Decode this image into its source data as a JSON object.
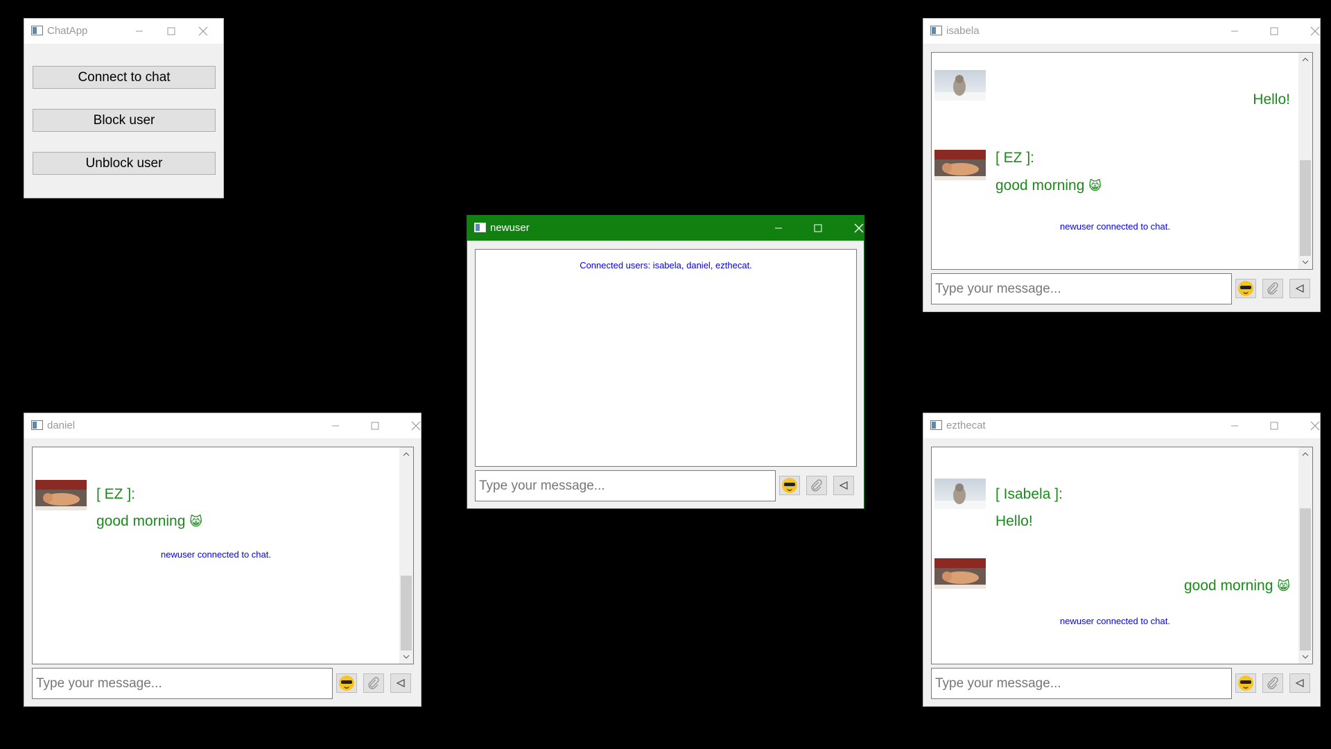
{
  "main_window": {
    "title": "ChatApp",
    "buttons": [
      "Connect to chat",
      "Block user",
      "Unblock user"
    ]
  },
  "windows": {
    "newuser": {
      "title": "newuser",
      "system_message": "Connected users: isabela, daniel, ezthecat.",
      "input_placeholder": "Type your message..."
    },
    "isabela": {
      "title": "isabela",
      "messages": [
        {
          "text": "Hello!",
          "align": "right"
        },
        {
          "sender": "[ EZ ]:",
          "text": "good morning",
          "emoji": "😸"
        }
      ],
      "system_message": "newuser connected to chat.",
      "input_placeholder": "Type your message..."
    },
    "daniel": {
      "title": "daniel",
      "messages": [
        {
          "sender": "[ EZ ]:",
          "text": "good morning",
          "emoji": "😸"
        }
      ],
      "system_message": "newuser connected to chat.",
      "input_placeholder": "Type your message..."
    },
    "ezthecat": {
      "title": "ezthecat",
      "messages": [
        {
          "sender": "[ Isabela ]:",
          "text": "Hello!"
        },
        {
          "text": "good morning",
          "emoji": "😸",
          "align": "right"
        }
      ],
      "system_message": "newuser connected to chat.",
      "input_placeholder": "Type your message..."
    }
  },
  "icons": [
    "app-icon",
    "minimize-icon",
    "maximize-icon",
    "close-icon",
    "sunglasses-emoji-icon",
    "paperclip-icon",
    "send-icon",
    "scroll-up-icon",
    "scroll-down-icon"
  ],
  "colors": {
    "active_titlebar": "#108010",
    "message_green": "#1a8a1a",
    "system_blue": "#0000ee",
    "desktop": "#000000"
  }
}
